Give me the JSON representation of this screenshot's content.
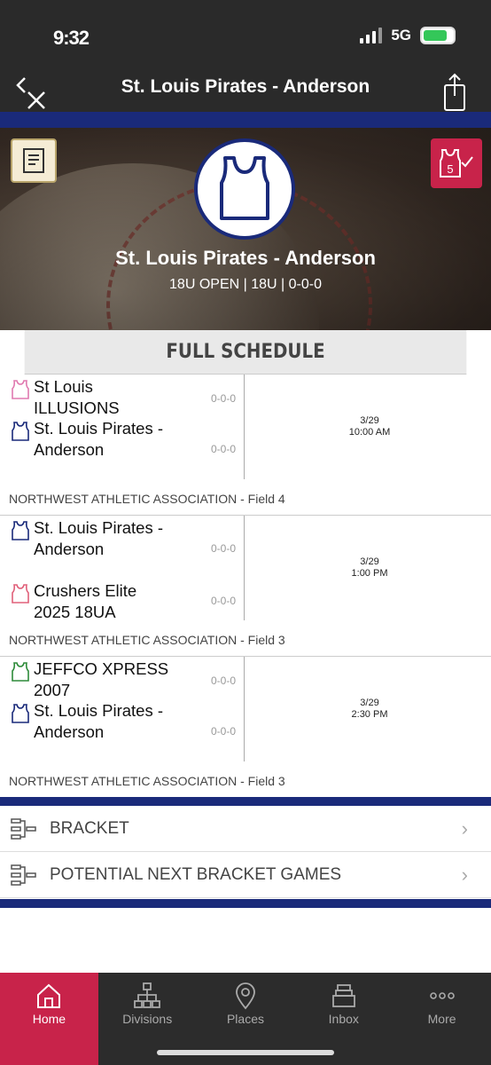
{
  "status": {
    "time": "9:32",
    "network": "5G"
  },
  "nav": {
    "title": "St. Louis Pirates - Anderson"
  },
  "hero": {
    "team_name": "St. Louis Pirates - Anderson",
    "subtitle": "18U OPEN | 18U | 0-0-0",
    "badge_number": "5"
  },
  "section": {
    "title": "FULL SCHEDULE"
  },
  "games": [
    {
      "home": {
        "name": "St Louis ILLUSIONS",
        "record": "0-0-0",
        "color": "#e07ab0"
      },
      "away": {
        "name": "St. Louis Pirates - Anderson",
        "record": "0-0-0",
        "color": "#1a2a7a"
      },
      "date": "3/29",
      "time": "10:00 AM",
      "venue": "NORTHWEST ATHLETIC ASSOCIATION - Field 4"
    },
    {
      "home": {
        "name": "St. Louis Pirates - Anderson",
        "record": "0-0-0",
        "color": "#1a2a7a"
      },
      "away": {
        "name": "Crushers Elite 2025 18UA",
        "record": "0-0-0",
        "color": "#e0607a"
      },
      "date": "3/29",
      "time": "1:00 PM",
      "venue": "NORTHWEST ATHLETIC ASSOCIATION - Field 3"
    },
    {
      "home": {
        "name": "JEFFCO XPRESS 2007",
        "record": "0-0-0",
        "color": "#2e8b3a"
      },
      "away": {
        "name": "St. Louis Pirates - Anderson",
        "record": "0-0-0",
        "color": "#1a2a7a"
      },
      "date": "3/29",
      "time": "2:30 PM",
      "venue": "NORTHWEST ATHLETIC ASSOCIATION - Field 3"
    }
  ],
  "links": [
    {
      "label": "BRACKET",
      "icon": "bracket-icon"
    },
    {
      "label": "POTENTIAL NEXT BRACKET GAMES",
      "icon": "bracket-icon"
    }
  ],
  "tabs": [
    {
      "label": "Home",
      "icon": "home-icon",
      "active": true
    },
    {
      "label": "Divisions",
      "icon": "divisions-icon",
      "active": false
    },
    {
      "label": "Places",
      "icon": "location-pin-icon",
      "active": false
    },
    {
      "label": "Inbox",
      "icon": "inbox-icon",
      "active": false
    },
    {
      "label": "More",
      "icon": "more-dots-icon",
      "active": false
    }
  ],
  "colors": {
    "accent": "#c8234a",
    "navy": "#1a2a7a",
    "dark": "#2c2c2c"
  }
}
